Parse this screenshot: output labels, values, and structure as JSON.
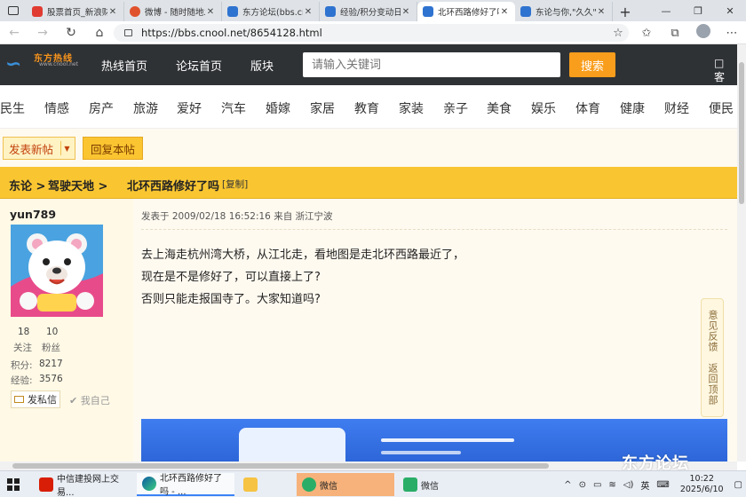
{
  "browser": {
    "tabs": [
      {
        "title": "股票首页_新浪财经",
        "color": "#e03c31"
      },
      {
        "title": "微博 - 随时随地发现新鲜事",
        "color": "#e0522c"
      },
      {
        "title": "东方论坛(bbs.cnool.net)",
        "color": "#2f73d0"
      },
      {
        "title": "经验/积分变动日志",
        "color": "#2f73d0"
      },
      {
        "title": "北环西路修好了吗",
        "color": "#2f73d0"
      },
      {
        "title": "东论与你,\"久久\"",
        "color": "#2f73d0"
      }
    ],
    "url": "https://bbs.cnool.net/8654128.html"
  },
  "site": {
    "logo_text": "东方热线",
    "logo_sub": "www.cnool.net",
    "nav": [
      "热线首页",
      "论坛首页",
      "版块"
    ],
    "search_placeholder": "请输入关键词",
    "search_button": "搜索",
    "login": "□ 客"
  },
  "categories": [
    "民生",
    "情感",
    "房产",
    "旅游",
    "爱好",
    "汽车",
    "婚嫁",
    "家居",
    "教育",
    "家装",
    "亲子",
    "美食",
    "娱乐",
    "体育",
    "健康",
    "财经",
    "便民"
  ],
  "actions": {
    "post": "发表新帖",
    "reply": "回复本帖"
  },
  "breadcrumb": {
    "root": "东论 >",
    "forum": "驾驶天地 >",
    "title": "北环西路修好了吗",
    "copy": "[复制]"
  },
  "user": {
    "name": "yun789",
    "follow_count": "18",
    "follow_label": "关注",
    "fans_count": "10",
    "fans_label": "粉丝",
    "points_label": "积分:",
    "points": "8217",
    "exp_label": "经验:",
    "exp": "3576",
    "message_button": "发私信",
    "self_label": "✔ 我自己"
  },
  "post": {
    "meta": "发表于 2009/02/18 16:52:16 来自 浙江宁波",
    "lines": [
      "去上海走杭州湾大桥，从江北走，看地图是走北环西路最近了，",
      "现在是不是修好了，可以直接上了?",
      "否则只能走报国寺了。大家知道吗?"
    ]
  },
  "float_side": {
    "feedback": "意见反馈",
    "top": "返回顶部"
  },
  "watermark": "东方论坛",
  "taskbar": {
    "apps": [
      "中信建投网上交易...",
      "北环西路修好了吗 - ...",
      "",
      "微信",
      "微信"
    ],
    "ime": "英",
    "time": "10:22",
    "date": "2025/6/10"
  }
}
